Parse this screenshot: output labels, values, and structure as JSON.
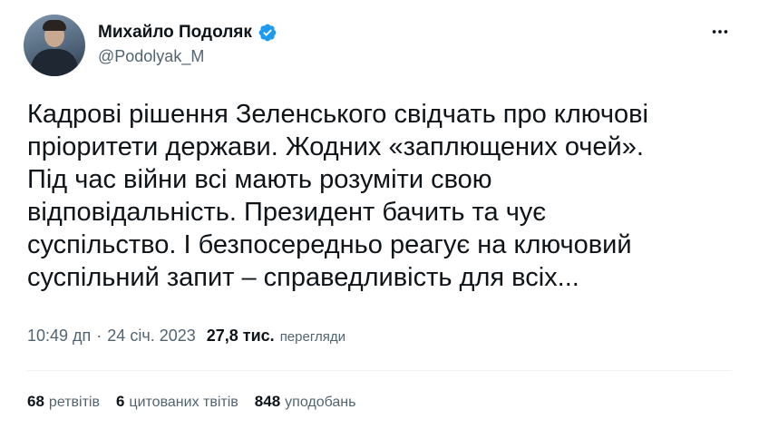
{
  "author": {
    "name": "Михайло Подоляк",
    "handle": "@Podolyak_M",
    "verified_color": "#1d9bf0"
  },
  "icons": {
    "verified": "verified-badge-icon",
    "more": "more-options-icon"
  },
  "tweet": {
    "lines": [
      "Кадрові рішення Зеленського свідчать про ключові",
      "пріоритети держави. Жодних «заплющених очей».",
      "Під час війни всі мають розуміти свою",
      "відповідальність. Президент бачить та чує",
      "суспільство. І безпосередньо реагує на ключовий",
      "суспільний запит – справедливість для всіх..."
    ],
    "time": "10:49 дп",
    "separator": "·",
    "date": "24 січ. 2023",
    "views_count": "27,8 тис.",
    "views_label": "перегляди"
  },
  "stats": {
    "retweets": {
      "count": "68",
      "label": "ретвітів"
    },
    "quotes": {
      "count": "6",
      "label": "цитованих твітів"
    },
    "likes": {
      "count": "848",
      "label": "уподобань"
    }
  }
}
